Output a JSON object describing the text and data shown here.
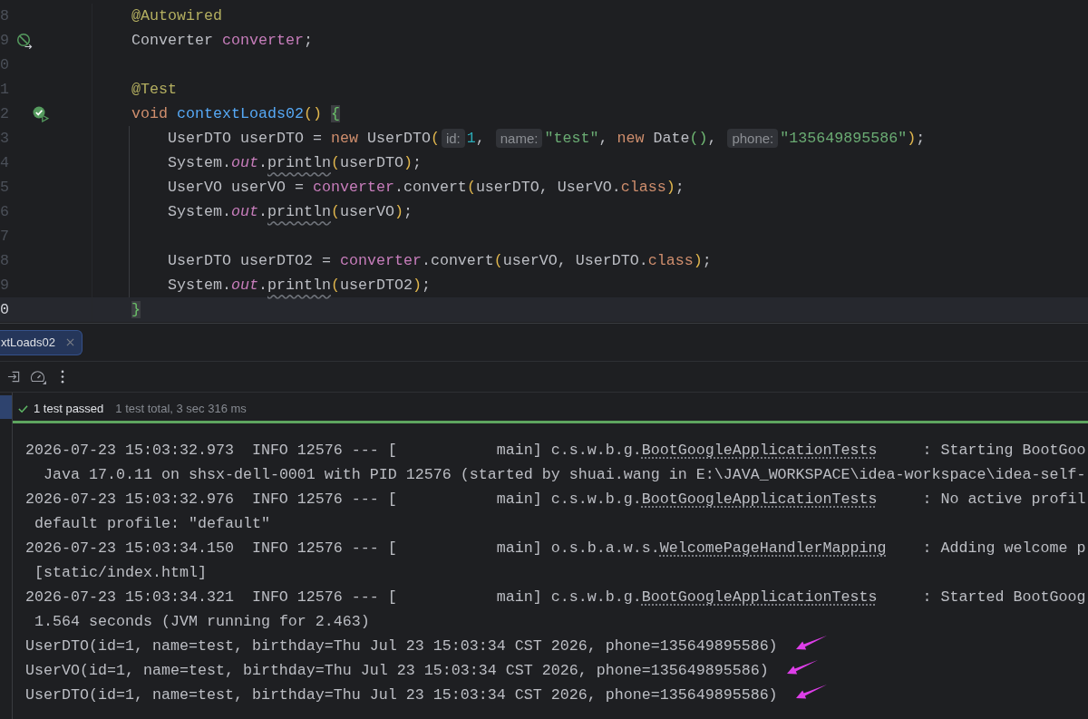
{
  "editor": {
    "lines": [
      {
        "number": "8",
        "current": false,
        "tokens": [
          {
            "text": "@Autowired",
            "kind": "annotation"
          }
        ]
      },
      {
        "number": "9",
        "current": false,
        "gutter_mark": {
          "kind": "injection"
        },
        "tokens": [
          {
            "text": "Converter ",
            "kind": "plain"
          },
          {
            "text": "converter",
            "kind": "field"
          },
          {
            "text": ";",
            "kind": "plain"
          }
        ]
      },
      {
        "number": "0",
        "current": false
      },
      {
        "number": "1",
        "current": false,
        "tokens": [
          {
            "text": "@Test",
            "kind": "annotation"
          }
        ]
      },
      {
        "number": "2",
        "current": false,
        "gutter_mark": {
          "kind": "test-passed"
        },
        "tokens": [
          {
            "text": "void",
            "kind": "keyword"
          },
          {
            "text": " contextLoads02",
            "kind": "method"
          },
          {
            "text": "() ",
            "kind": "paren"
          },
          {
            "text": "{",
            "kind": "brace"
          }
        ],
        "children": [
          {
            "number": "3",
            "current": false,
            "tokens": [
              {
                "text": "UserDTO userDTO = ",
                "kind": "plain"
              },
              {
                "text": "new",
                "kind": "keyword"
              },
              {
                "text": " UserDTO",
                "kind": "plain"
              },
              {
                "text": "(",
                "kind": "paren"
              },
              {
                "text": "id:",
                "kind": "hint"
              },
              {
                "text": "1",
                "kind": "number"
              },
              {
                "text": ", ",
                "kind": "plain"
              },
              {
                "text": "name:",
                "kind": "hint"
              },
              {
                "text": "\"test\"",
                "kind": "string"
              },
              {
                "text": ", ",
                "kind": "plain"
              },
              {
                "text": "new",
                "kind": "keyword"
              },
              {
                "text": " Date",
                "kind": "plain"
              },
              {
                "text": "()",
                "kind": "paren2"
              },
              {
                "text": ", ",
                "kind": "plain"
              },
              {
                "text": "phone:",
                "kind": "hint"
              },
              {
                "text": "\"135649895586\"",
                "kind": "string"
              },
              {
                "text": ")",
                "kind": "paren"
              },
              {
                "text": ";",
                "kind": "plain"
              }
            ]
          },
          {
            "number": "4",
            "current": false,
            "tokens": [
              {
                "text": "System.",
                "kind": "plain"
              },
              {
                "text": "out",
                "kind": "static"
              },
              {
                "text": ".",
                "kind": "plain"
              },
              {
                "text": "println",
                "kind": "underlined"
              },
              {
                "text": "(",
                "kind": "paren"
              },
              {
                "text": "userDTO",
                "kind": "plain"
              },
              {
                "text": ")",
                "kind": "paren"
              },
              {
                "text": ";",
                "kind": "plain"
              }
            ]
          },
          {
            "number": "5",
            "current": false,
            "tokens": [
              {
                "text": "UserVO userVO = ",
                "kind": "plain"
              },
              {
                "text": "converter",
                "kind": "field"
              },
              {
                "text": ".convert",
                "kind": "plain"
              },
              {
                "text": "(",
                "kind": "paren"
              },
              {
                "text": "userDTO, UserVO.",
                "kind": "plain"
              },
              {
                "text": "class",
                "kind": "keyword"
              },
              {
                "text": ")",
                "kind": "paren"
              },
              {
                "text": ";",
                "kind": "plain"
              }
            ]
          },
          {
            "number": "6",
            "current": false,
            "tokens": [
              {
                "text": "System.",
                "kind": "plain"
              },
              {
                "text": "out",
                "kind": "static"
              },
              {
                "text": ".",
                "kind": "plain"
              },
              {
                "text": "println",
                "kind": "underlined"
              },
              {
                "text": "(",
                "kind": "paren"
              },
              {
                "text": "userVO",
                "kind": "plain"
              },
              {
                "text": ")",
                "kind": "paren"
              },
              {
                "text": ";",
                "kind": "plain"
              }
            ]
          },
          {
            "number": "7",
            "current": false
          },
          {
            "number": "8",
            "current": false,
            "tokens": [
              {
                "text": "UserDTO userDTO2 = ",
                "kind": "plain"
              },
              {
                "text": "converter",
                "kind": "field"
              },
              {
                "text": ".convert",
                "kind": "plain"
              },
              {
                "text": "(",
                "kind": "paren"
              },
              {
                "text": "userVO, UserDTO.",
                "kind": "plain"
              },
              {
                "text": "class",
                "kind": "keyword"
              },
              {
                "text": ")",
                "kind": "paren"
              },
              {
                "text": ";",
                "kind": "plain"
              }
            ]
          },
          {
            "number": "9",
            "current": false,
            "tokens": [
              {
                "text": "System.",
                "kind": "plain"
              },
              {
                "text": "out",
                "kind": "static"
              },
              {
                "text": ".",
                "kind": "plain"
              },
              {
                "text": "println",
                "kind": "underlined"
              },
              {
                "text": "(",
                "kind": "paren"
              },
              {
                "text": "userDTO2",
                "kind": "plain"
              },
              {
                "text": ")",
                "kind": "paren"
              },
              {
                "text": ";",
                "kind": "plain"
              }
            ]
          }
        ]
      },
      {
        "number": "0",
        "current": true,
        "tokens": [
          {
            "text": "}",
            "kind": "brace"
          }
        ]
      }
    ]
  },
  "run_tabs": [
    {
      "label": "xtLoads02",
      "selected": true
    }
  ],
  "test_tree": {
    "items": [
      {
        "selected": true
      }
    ]
  },
  "status": {
    "passed": true,
    "result": "1 test passed",
    "summary": "1 test total, 3 sec 316 ms"
  },
  "progress": {
    "level": 1
  },
  "console": {
    "lines": [
      {
        "kind": "log",
        "marked": false,
        "parts": [
          {
            "kind": "text",
            "text": "2026-07-23 15:03:32.973  INFO 12576 --- [           main] c.s.w.b.g."
          },
          {
            "kind": "link",
            "text": "BootGoogleApplicationTests"
          },
          {
            "kind": "text",
            "text": "     : Starting BootGoo"
          }
        ]
      },
      {
        "kind": "wrap",
        "marked": false,
        "parts": [
          {
            "kind": "text",
            "text": " Java 17.0.11 on shsx-dell-0001 with PID 12576 (started by shuai.wang in E:\\JAVA_WORKSPACE\\idea-workspace\\idea-self-"
          }
        ]
      },
      {
        "kind": "log",
        "marked": false,
        "parts": [
          {
            "kind": "text",
            "text": "2026-07-23 15:03:32.976  INFO 12576 --- [           main] c.s.w.b.g."
          },
          {
            "kind": "link",
            "text": "BootGoogleApplicationTests"
          },
          {
            "kind": "text",
            "text": "     : No active profil"
          }
        ]
      },
      {
        "kind": "wrap",
        "marked": false,
        "parts": [
          {
            "kind": "text",
            "text": "default profile: \"default\""
          }
        ]
      },
      {
        "kind": "log",
        "marked": false,
        "parts": [
          {
            "kind": "text",
            "text": "2026-07-23 15:03:34.150  INFO 12576 --- [           main] o.s.b.a.w.s."
          },
          {
            "kind": "link",
            "text": "WelcomePageHandlerMapping"
          },
          {
            "kind": "text",
            "text": "    : Adding welcome p"
          }
        ]
      },
      {
        "kind": "wrap",
        "marked": false,
        "parts": [
          {
            "kind": "text",
            "text": "[static/index.html]"
          }
        ]
      },
      {
        "kind": "log",
        "marked": false,
        "parts": [
          {
            "kind": "text",
            "text": "2026-07-23 15:03:34.321  INFO 12576 --- [           main] c.s.w.b.g."
          },
          {
            "kind": "link",
            "text": "BootGoogleApplicationTests"
          },
          {
            "kind": "text",
            "text": "     : Started BootGoog"
          }
        ]
      },
      {
        "kind": "wrap",
        "marked": false,
        "parts": [
          {
            "kind": "text",
            "text": "1.564 seconds (JVM running for 2.463)"
          }
        ]
      },
      {
        "kind": "out",
        "marked": true,
        "parts": [
          {
            "kind": "text",
            "text": "UserDTO(id=1, name=test, birthday=Thu Jul 23 15:03:34 CST 2026, phone=135649895586)"
          }
        ]
      },
      {
        "kind": "out",
        "marked": true,
        "parts": [
          {
            "kind": "text",
            "text": "UserVO(id=1, name=test, birthday=Thu Jul 23 15:03:34 CST 2026, phone=135649895586)"
          }
        ]
      },
      {
        "kind": "out",
        "marked": true,
        "parts": [
          {
            "kind": "text",
            "text": "UserDTO(id=1, name=test, birthday=Thu Jul 23 15:03:34 CST 2026, phone=135649895586)"
          }
        ]
      }
    ]
  }
}
